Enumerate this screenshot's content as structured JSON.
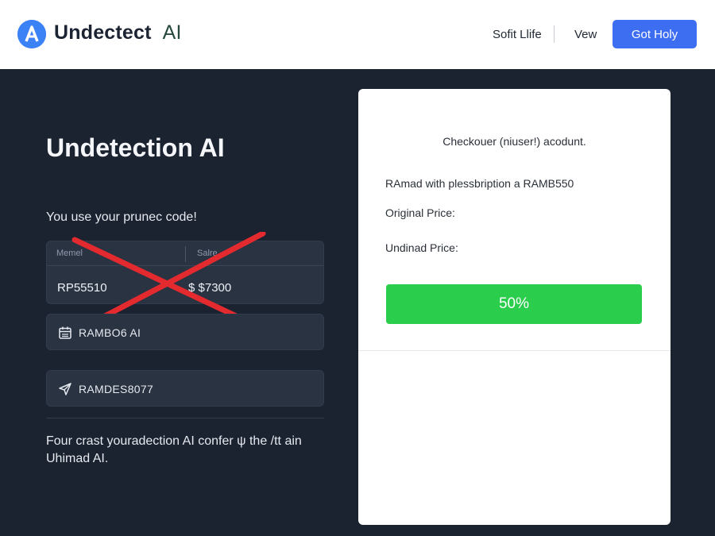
{
  "header": {
    "brand_name": "Undectect",
    "brand_suffix": "AI",
    "nav_links": [
      "Sofit Llife",
      "Vew"
    ],
    "cta_label": "Got Holy",
    "logo_icon": "a-logo-icon"
  },
  "hero": {
    "title": "Undetection AI",
    "subtitle": "You use your prunec code!"
  },
  "price_table": {
    "headers": [
      "Memel",
      "Salre"
    ],
    "values": [
      "RP55510",
      "$ $7300"
    ],
    "struck_through": true,
    "strike_color": "#e32a2f"
  },
  "code_boxes": [
    {
      "icon": "calendar-icon",
      "label": "RAMBO6 AI"
    },
    {
      "icon": "send-arrow-icon",
      "label": "RAMDES8077"
    }
  ],
  "footer": {
    "text": "Four crast youradection AI confer ψ the /tt ain Uhimad AI."
  },
  "checkout": {
    "title": "Checkouer (niuser!) acodunt.",
    "line1": "RAmad with plessbription a RAMB550",
    "original_price_label": "Original Price:",
    "undinad_price_label": "Undinad Price:",
    "discount_label": "50%"
  },
  "colors": {
    "background": "#1b2230",
    "accent": "#3d6ef2",
    "discount": "#2bcd4d"
  }
}
